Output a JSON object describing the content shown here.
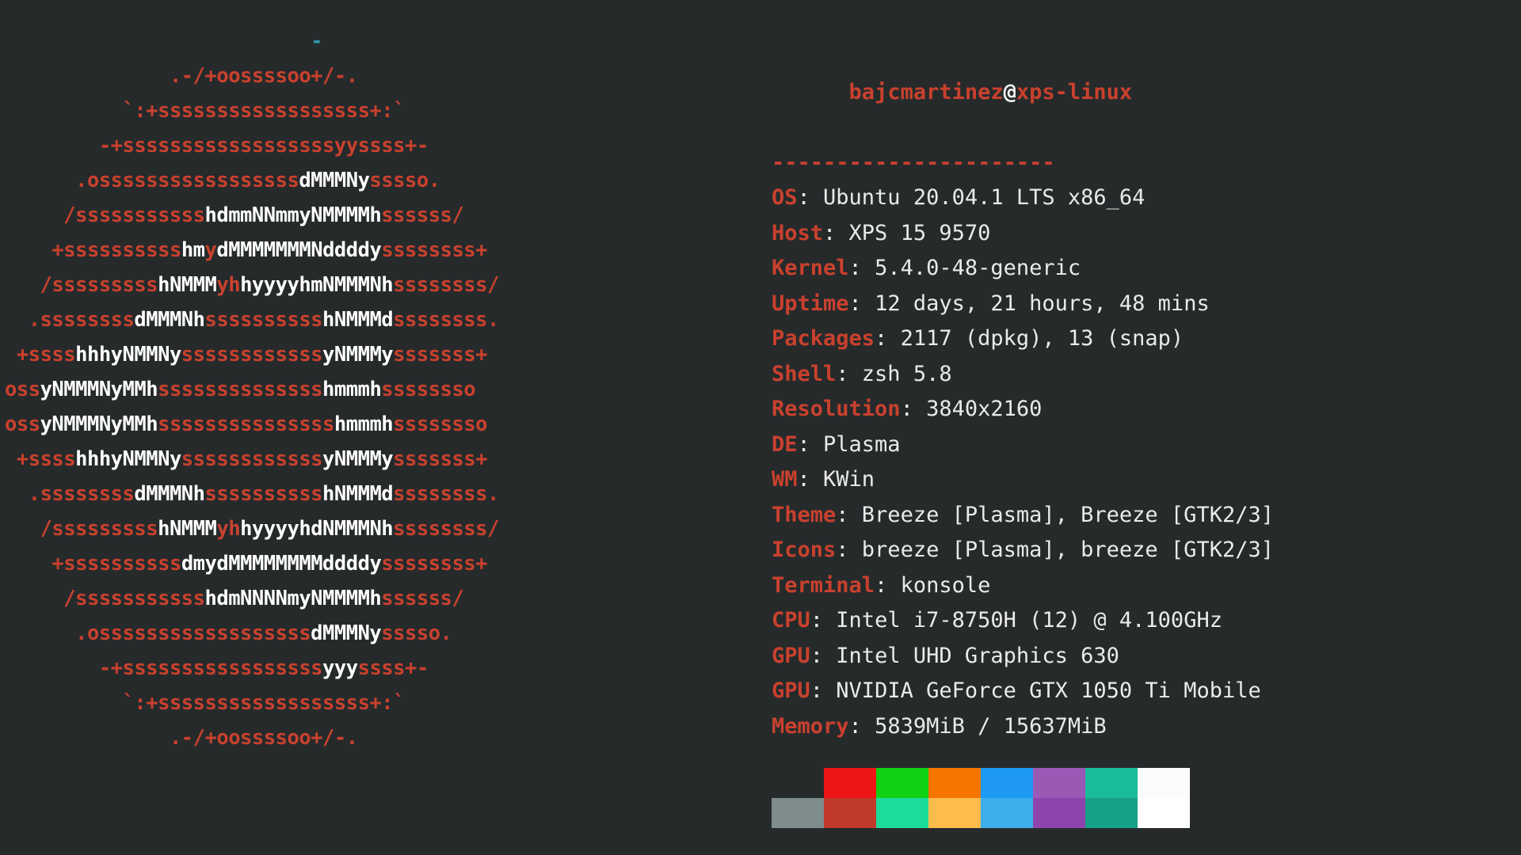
{
  "terminal": {
    "background_color": "#262a2b",
    "foreground_color": "#eaeaea",
    "accent_color": "#c9412e"
  },
  "header": {
    "user": "bajcmartinez",
    "at": "@",
    "host": "xps-linux",
    "rule": "----------------------"
  },
  "info": [
    {
      "key": "OS",
      "sep": ": ",
      "value": "Ubuntu 20.04.1 LTS x86_64"
    },
    {
      "key": "Host",
      "sep": ": ",
      "value": "XPS 15 9570"
    },
    {
      "key": "Kernel",
      "sep": ": ",
      "value": "5.4.0-48-generic"
    },
    {
      "key": "Uptime",
      "sep": ": ",
      "value": "12 days, 21 hours, 48 mins"
    },
    {
      "key": "Packages",
      "sep": ": ",
      "value": "2117 (dpkg), 13 (snap)"
    },
    {
      "key": "Shell",
      "sep": ": ",
      "value": "zsh 5.8"
    },
    {
      "key": "Resolution",
      "sep": ": ",
      "value": "3840x2160"
    },
    {
      "key": "DE",
      "sep": ": ",
      "value": "Plasma"
    },
    {
      "key": "WM",
      "sep": ": ",
      "value": "KWin"
    },
    {
      "key": "Theme",
      "sep": ": ",
      "value": "Breeze [Plasma], Breeze [GTK2/3]"
    },
    {
      "key": "Icons",
      "sep": ": ",
      "value": "breeze [Plasma], breeze [GTK2/3]"
    },
    {
      "key": "Terminal",
      "sep": ": ",
      "value": "konsole"
    },
    {
      "key": "CPU",
      "sep": ": ",
      "value": "Intel i7-8750H (12) @ 4.100GHz"
    },
    {
      "key": "GPU",
      "sep": ": ",
      "value": "Intel UHD Graphics 630"
    },
    {
      "key": "GPU",
      "sep": ": ",
      "value": "NVIDIA GeForce GTX 1050 Ti Mobile"
    },
    {
      "key": "Memory",
      "sep": ": ",
      "value": "5839MiB / 15637MiB"
    }
  ],
  "palette": {
    "row1": [
      "#262a2b",
      "#ed1515",
      "#11d116",
      "#f67400",
      "#1d99f3",
      "#9b59b6",
      "#1abc9c",
      "#fcfcfc"
    ],
    "row2": [
      "#7f8c8d",
      "#c0392b",
      "#1cdc9a",
      "#fdbc4b",
      "#3daee9",
      "#8e44ad",
      "#16a085",
      "#ffffff"
    ]
  },
  "ascii_art": {
    "distro": "ubuntu",
    "lines": [
      [
        [
          "s",
          26
        ],
        [
          "c",
          "-"
        ]
      ],
      [
        [
          "s",
          14
        ],
        [
          "r",
          ".-/+oossssoo+/-."
        ]
      ],
      [
        [
          "s",
          10
        ],
        [
          "r",
          "`:+ssssssssssssssssss+:`"
        ]
      ],
      [
        [
          "s",
          8
        ],
        [
          "r",
          "-+ssssssssssssssssssyyssss+-"
        ]
      ],
      [
        [
          "s",
          6
        ],
        [
          "r",
          ".osssssssssssssssss"
        ],
        [
          "w",
          "dMMMNy"
        ],
        [
          "r",
          "sssso."
        ]
      ],
      [
        [
          "s",
          5
        ],
        [
          "r",
          "/sssssssssss"
        ],
        [
          "w",
          "hdmmNNmmyNMMMMh"
        ],
        [
          "r",
          "ssssss/"
        ]
      ],
      [
        [
          "s",
          4
        ],
        [
          "r",
          "+ssssssssss"
        ],
        [
          "w",
          "hm"
        ],
        [
          "r",
          "y"
        ],
        [
          "w",
          "d"
        ],
        [
          "w",
          "MMMMMMMNddddy"
        ],
        [
          "r",
          "ssssssss+"
        ]
      ],
      [
        [
          "s",
          3
        ],
        [
          "r",
          "/sssssssss"
        ],
        [
          "w",
          "hNMMM"
        ],
        [
          "r",
          "yh"
        ],
        [
          "w",
          "hyyyyhmNMMMNh"
        ],
        [
          "r",
          "ssssssss/"
        ]
      ],
      [
        [
          "s",
          2
        ],
        [
          "r",
          ".ssssssss"
        ],
        [
          "w",
          "dMMMNh"
        ],
        [
          "r",
          "ssssssssss"
        ],
        [
          "w",
          "hNMMMd"
        ],
        [
          "r",
          "ssssssss."
        ]
      ],
      [
        [
          "s",
          1
        ],
        [
          "r",
          "+ssss"
        ],
        [
          "w",
          "hhhyNMMNy"
        ],
        [
          "r",
          "ssssssssssss"
        ],
        [
          "w",
          "yNMMMy"
        ],
        [
          "r",
          "sssssss+"
        ]
      ],
      [
        [
          "s",
          0
        ],
        [
          "r",
          "oss"
        ],
        [
          "w",
          "yNMMMNyMMh"
        ],
        [
          "r",
          "ssssssssssssss"
        ],
        [
          "w",
          "hmmmh"
        ],
        [
          "r",
          "ssssssso"
        ]
      ],
      [
        [
          "s",
          0
        ],
        [
          "r",
          "oss"
        ],
        [
          "w",
          "yNMMMNyMMh"
        ],
        [
          "r",
          "sssssssssssssss"
        ],
        [
          "w",
          "hmmmh"
        ],
        [
          "r",
          "ssssssso"
        ]
      ],
      [
        [
          "s",
          1
        ],
        [
          "r",
          "+ssss"
        ],
        [
          "w",
          "hhhyNMMNy"
        ],
        [
          "r",
          "ssssssssssss"
        ],
        [
          "w",
          "yNMMMy"
        ],
        [
          "r",
          "sssssss+"
        ]
      ],
      [
        [
          "s",
          2
        ],
        [
          "r",
          ".ssssssss"
        ],
        [
          "w",
          "dMMMNh"
        ],
        [
          "r",
          "ssssssssss"
        ],
        [
          "w",
          "hNMMMd"
        ],
        [
          "r",
          "ssssssss."
        ]
      ],
      [
        [
          "s",
          3
        ],
        [
          "r",
          "/sssssssss"
        ],
        [
          "w",
          "hNMMM"
        ],
        [
          "r",
          "yh"
        ],
        [
          "w",
          "hyyyyhdNMMMNh"
        ],
        [
          "r",
          "ssssssss/"
        ]
      ],
      [
        [
          "s",
          4
        ],
        [
          "r",
          "+ssssssssss"
        ],
        [
          "w",
          "dmyd"
        ],
        [
          "w",
          "MMMMMMMMddddy"
        ],
        [
          "r",
          "ssssssss+"
        ]
      ],
      [
        [
          "s",
          5
        ],
        [
          "r",
          "/sssssssssss"
        ],
        [
          "w",
          "hdmNNNNmyNMMMMh"
        ],
        [
          "r",
          "ssssss/"
        ]
      ],
      [
        [
          "s",
          6
        ],
        [
          "r",
          ".ossssssssssssssssss"
        ],
        [
          "w",
          "dMMMNy"
        ],
        [
          "r",
          "sssso."
        ]
      ],
      [
        [
          "s",
          8
        ],
        [
          "r",
          "-+sssssssssssssssss"
        ],
        [
          "w",
          "yyy"
        ],
        [
          "r",
          "ssss+-"
        ]
      ],
      [
        [
          "s",
          10
        ],
        [
          "r",
          "`:+ssssssssssssssssss+:`"
        ]
      ],
      [
        [
          "s",
          14
        ],
        [
          "r",
          ".-/+oossssoo+/-."
        ]
      ]
    ]
  }
}
